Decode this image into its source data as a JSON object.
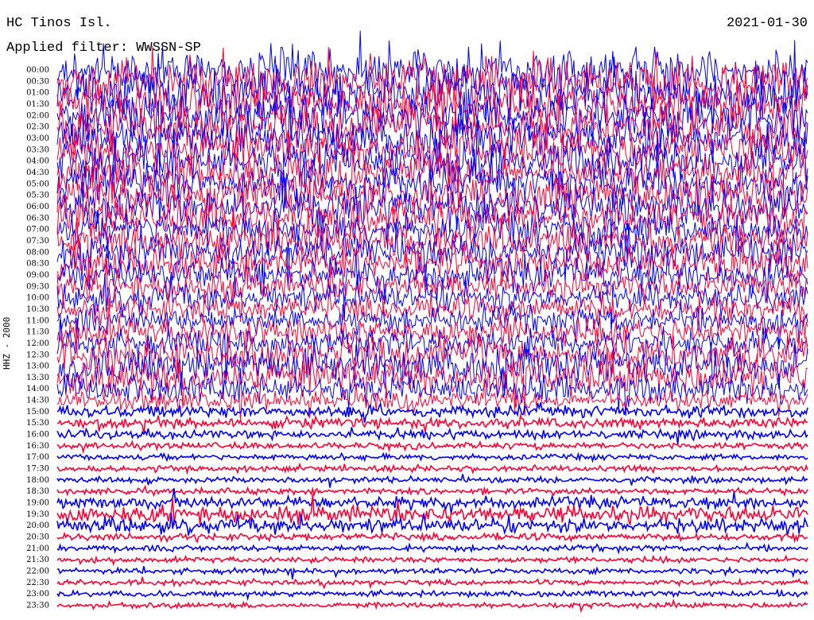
{
  "header": {
    "station": "HC Tinos Isl.",
    "date": "2021-01-30",
    "filter": "Applied filter: WWSSN-SP"
  },
  "channel_label": "HHZ - 2000",
  "colors": {
    "trace_a": "#0000ff",
    "trace_b": "#ff0033",
    "text": "#000000",
    "background": "#ffffff"
  },
  "chart_data": {
    "type": "helicorder",
    "title": "HC Tinos Isl.",
    "date": "2021-01-30",
    "filter": "WWSSN-SP",
    "channel": "HHZ - 2000",
    "row_minutes": 30,
    "trace_colors_alternating": [
      "blue",
      "red"
    ],
    "row_labels": [
      "00:00",
      "00:30",
      "01:00",
      "01:30",
      "02:00",
      "02:30",
      "03:00",
      "03:30",
      "04:00",
      "04:30",
      "05:00",
      "05:30",
      "06:00",
      "06:30",
      "07:00",
      "07:30",
      "08:00",
      "08:30",
      "09:00",
      "09:30",
      "10:00",
      "10:30",
      "11:00",
      "11:30",
      "12:00",
      "12:30",
      "13:00",
      "13:30",
      "14:00",
      "14:30",
      "15:00",
      "15:30",
      "16:00",
      "16:30",
      "17:00",
      "17:30",
      "18:00",
      "18:30",
      "19:00",
      "19:30",
      "20:00",
      "20:30",
      "21:00",
      "21:30",
      "22:00",
      "22:30",
      "23:00",
      "23:30"
    ],
    "relative_noise_amplitude": [
      1.0,
      1.0,
      1.0,
      1.0,
      1.0,
      0.95,
      0.9,
      0.9,
      0.9,
      0.85,
      0.85,
      0.85,
      0.8,
      0.8,
      0.75,
      0.75,
      0.75,
      0.75,
      0.7,
      0.6,
      0.6,
      0.55,
      0.55,
      0.6,
      0.6,
      0.8,
      0.8,
      0.8,
      0.6,
      0.4,
      0.2,
      0.15,
      0.12,
      0.06,
      0.05,
      0.05,
      0.05,
      0.05,
      0.2,
      0.3,
      0.25,
      0.08,
      0.05,
      0.04,
      0.04,
      0.04,
      0.04,
      0.04
    ]
  }
}
